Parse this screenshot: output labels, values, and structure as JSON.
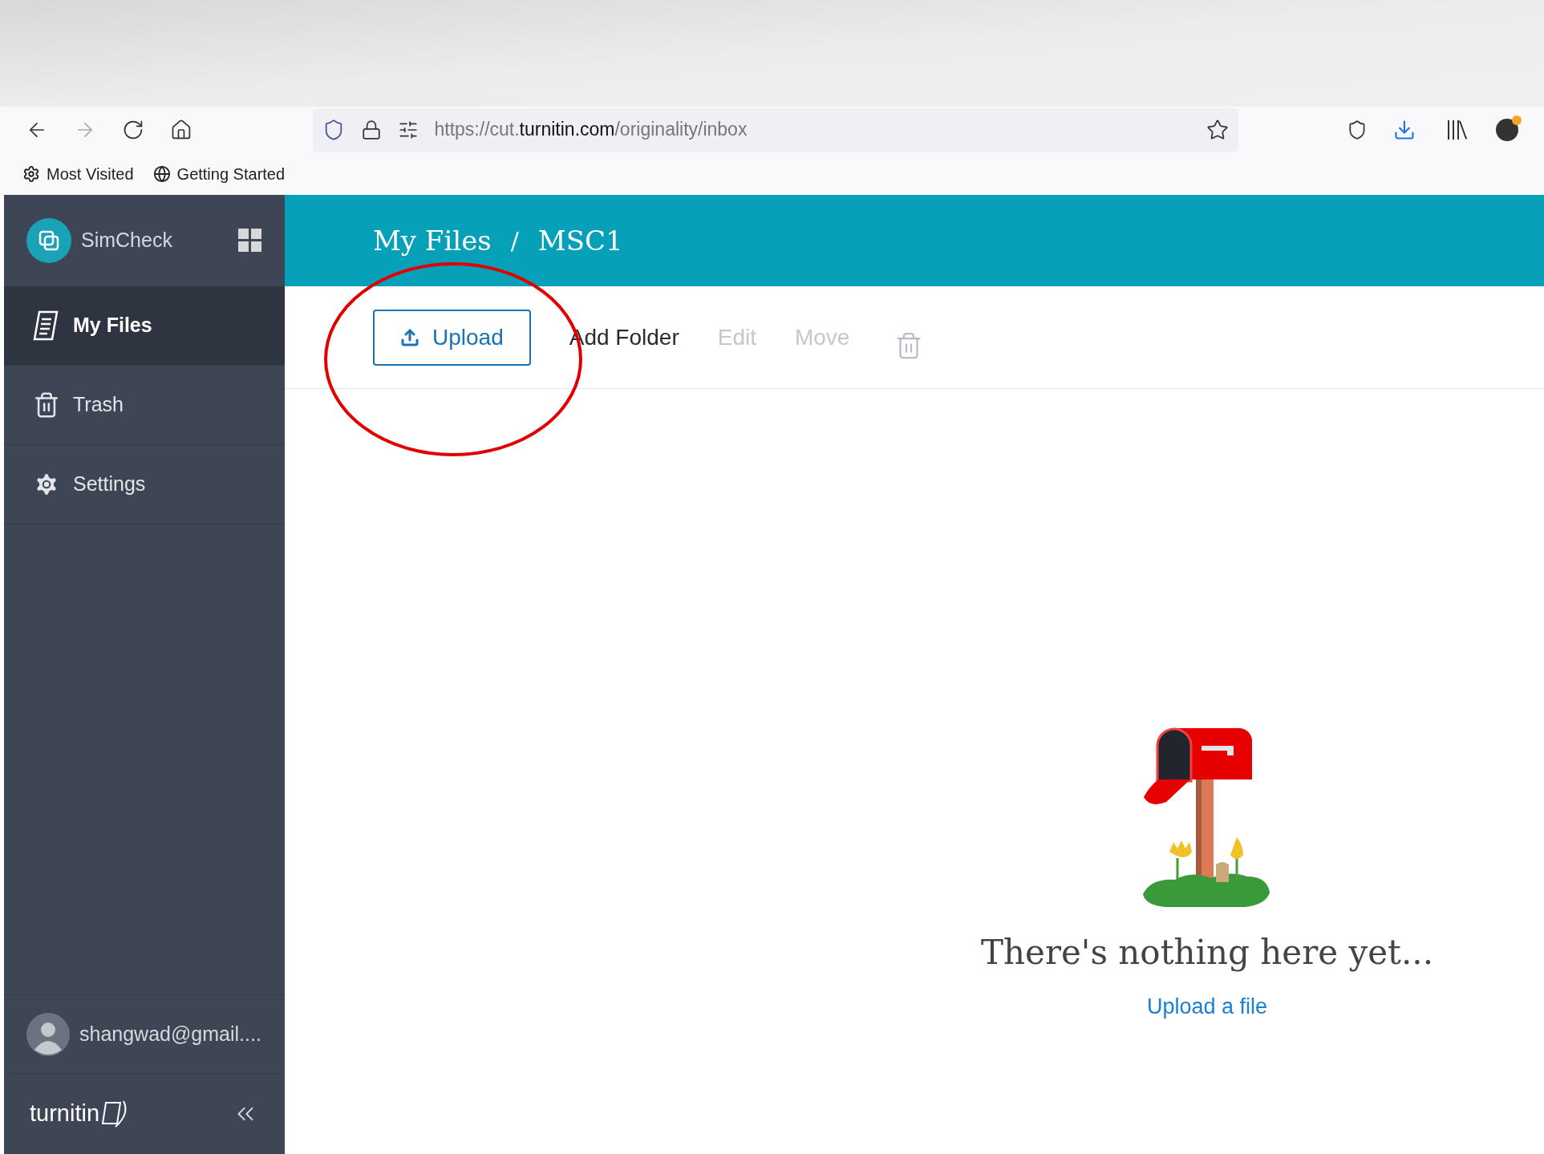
{
  "browser": {
    "url": "https://cut.**turnitin.com**/originality/inbox",
    "bookmarks": [
      "Most Visited",
      "Getting Started"
    ]
  },
  "sidebar": {
    "app_name": "SimCheck",
    "items": [
      {
        "label": "My Files",
        "kind": "files",
        "selected": true
      },
      {
        "label": "Trash",
        "kind": "trash",
        "selected": false
      },
      {
        "label": "Settings",
        "kind": "settings",
        "selected": false
      }
    ],
    "user": "shangwad@gmail....",
    "logo": "turnitin"
  },
  "header": {
    "breadcrumb": [
      "My Files",
      "MSC1"
    ],
    "separator": "/"
  },
  "toolbar": [
    {
      "label": "Upload",
      "kind": "primary",
      "disabled": false
    },
    {
      "label": "Add Folder",
      "kind": "text",
      "disabled": false
    },
    {
      "label": "Edit",
      "kind": "text",
      "disabled": true
    },
    {
      "label": "Move",
      "kind": "text",
      "disabled": true
    },
    {
      "kind": "trash",
      "disabled": true
    }
  ],
  "empty_state": {
    "message": "There's nothing here yet...",
    "link": "Upload a file"
  },
  "annotation": {
    "kind": "ellipse",
    "color": "#e00000"
  }
}
